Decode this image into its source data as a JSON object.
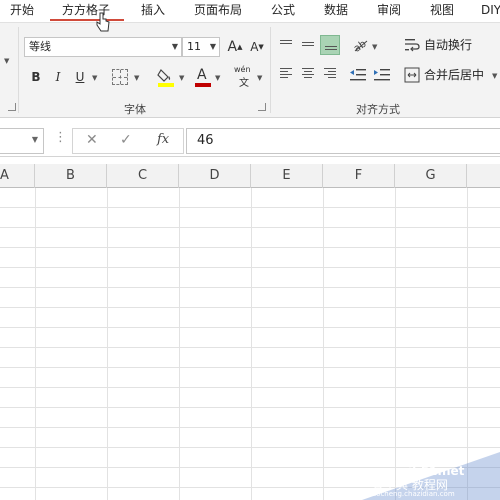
{
  "ribbon_tabs": [
    {
      "label": "开始"
    },
    {
      "label": "方方格子"
    },
    {
      "label": "插入"
    },
    {
      "label": "页面布局"
    },
    {
      "label": "公式"
    },
    {
      "label": "数据"
    },
    {
      "label": "审阅"
    },
    {
      "label": "视图"
    },
    {
      "label": "DIY"
    }
  ],
  "font_group": {
    "font_name": "等线",
    "font_size": "11",
    "grow_font": "A",
    "shrink_font": "A",
    "bold": "B",
    "italic": "I",
    "underline": "U",
    "font_color": "A",
    "phonetic_top": "wén",
    "phonetic_bottom": "文",
    "label": "字体"
  },
  "alignment_group": {
    "wrap_text": "自动换行",
    "merge_center": "合并后居中",
    "label": "对齐方式"
  },
  "formula_bar": {
    "cancel_symbol": "✕",
    "enter_symbol": "✓",
    "fx": "fx",
    "value": "46"
  },
  "columns": [
    "A",
    "B",
    "C",
    "D",
    "E",
    "F",
    "G"
  ],
  "watermark": {
    "line1": "jb51.net",
    "line2": "查字典 教程网",
    "line3": "jiaocheng.chazidian.com"
  },
  "colors": {
    "tab_underline": "#d04a3a",
    "selected_align": "#a9d3b4",
    "font_color_bar": "#c00000",
    "fill_color_bar": "#ffff00"
  }
}
